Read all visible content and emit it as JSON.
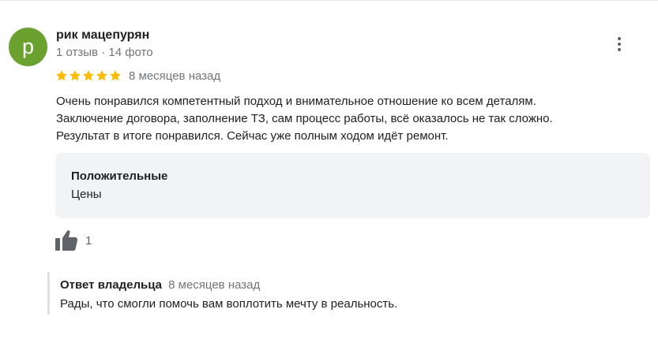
{
  "review": {
    "author": {
      "initial": "p",
      "name": "рик мацепурян",
      "meta": "1 отзыв · 14 фото",
      "avatar_color": "#6aa12f"
    },
    "rating": 5,
    "star_color": "#fbbc04",
    "date": "8 месяцев назад",
    "text_lines": [
      "Очень понравился компетентный подход и внимательное отношение ко всем деталям.",
      "Заключение договора, заполнение ТЗ, сам процесс работы, всё оказалось не так сложно.",
      "Результат в итоге понравился. Сейчас уже полным ходом идёт ремонт."
    ],
    "attributes": {
      "title": "Положительные",
      "value": "Цены"
    },
    "likes": "1",
    "menu_icon": "more-vert-icon",
    "like_icon": "thumb-up-icon"
  },
  "owner_reply": {
    "title": "Ответ владельца",
    "date": "8 месяцев назад",
    "text": "Рады, что смогли помочь вам воплотить мечту в реальность."
  }
}
